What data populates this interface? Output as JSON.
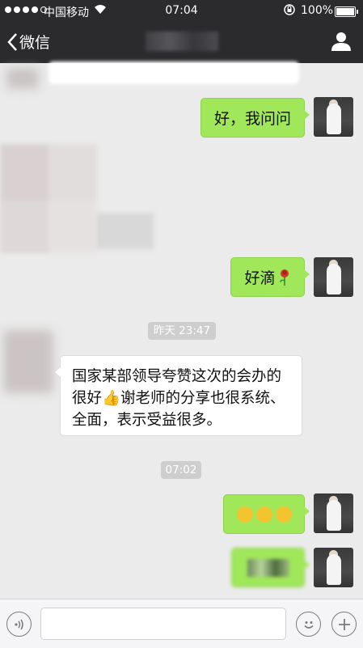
{
  "status": {
    "carrier": "中国移动",
    "time": "07:04",
    "battery": "100%"
  },
  "nav": {
    "back_label": "微信"
  },
  "messages": [
    {
      "side": "right",
      "text": "好，我问问"
    },
    {
      "side": "right",
      "text": "好滴"
    },
    {
      "side": "left",
      "text": "国家某部领导夸赞这次的会办的很好👍谢老师的分享也很系统、全面，表示受益很多。"
    }
  ],
  "timestamps": [
    "昨天 23:47",
    "07:02"
  ],
  "icons": {
    "back": "chevron-left-icon",
    "profile": "person-icon",
    "voice": "voice-icon",
    "emoji": "smiley-icon",
    "more": "plus-icon",
    "flower": "rose-icon"
  },
  "colors": {
    "chrome": "#2b2b2e",
    "background": "#ebebeb",
    "bubble_green": "#a0e75a",
    "bubble_white": "#ffffff"
  }
}
